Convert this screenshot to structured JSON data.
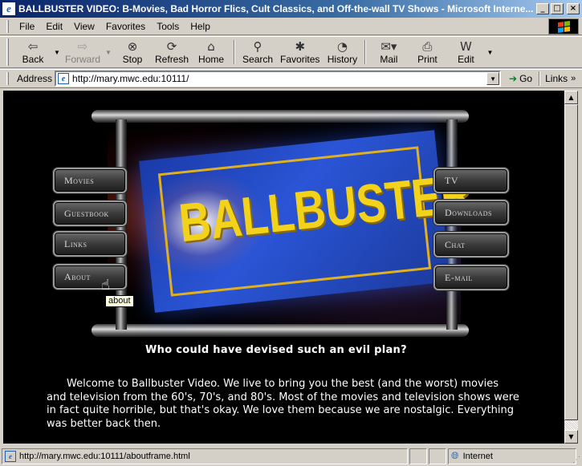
{
  "window": {
    "title": "BALLBUSTER VIDEO: B-Movies, Bad Horror Flics, Cult Classics, and Off-the-wall TV Shows - Microsoft Interne...",
    "minimize": "_",
    "maximize": "□",
    "close": "×"
  },
  "menu": [
    "File",
    "Edit",
    "View",
    "Favorites",
    "Tools",
    "Help"
  ],
  "toolbar": {
    "back": "Back",
    "forward": "Forward",
    "stop": "Stop",
    "refresh": "Refresh",
    "home": "Home",
    "search": "Search",
    "favorites": "Favorites",
    "history": "History",
    "mail": "Mail",
    "print": "Print",
    "edit": "Edit"
  },
  "address": {
    "label": "Address",
    "url": "http://mary.mwc.edu:10111/",
    "go": "Go",
    "links": "Links"
  },
  "page": {
    "logo_text": "BALLBUSTER",
    "nav_left": [
      "Movies",
      "Guestbook",
      "Links",
      "About"
    ],
    "nav_right": [
      "TV",
      "Downloads",
      "Chat",
      "E-mail"
    ],
    "tooltip": "about",
    "tagline": "Who could have devised such an evil plan?",
    "welcome": "Welcome to Ballbuster Video. We live to bring you the best (and the worst) movies and television from the 60's, 70's, and 80's. Most of the movies and television shows were in fact quite horrible, but that's okay. We love them because we are nostalgic. Everything was better back then."
  },
  "status": {
    "url": "http://mary.mwc.edu:10111/aboutframe.html",
    "zone": "Internet"
  }
}
